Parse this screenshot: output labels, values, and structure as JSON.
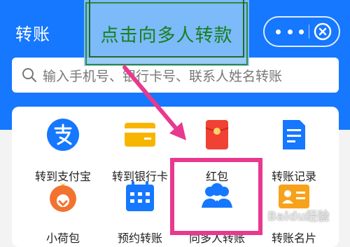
{
  "header": {
    "title": "转账",
    "more_icon": "more-dots-icon",
    "close_icon": "close-circle-icon"
  },
  "search": {
    "icon": "search-icon",
    "placeholder": "输入手机号、银行卡号、联系人姓名转账"
  },
  "grid": {
    "items": [
      {
        "label": "转到支付宝",
        "icon": "alipay-icon",
        "color": "#1677ff"
      },
      {
        "label": "转到银行卡",
        "icon": "bank-card-icon",
        "color": "#f7b500"
      },
      {
        "label": "红包",
        "icon": "red-packet-icon",
        "color": "#f04134"
      },
      {
        "label": "转账记录",
        "icon": "transfer-record-icon",
        "color": "#1677ff"
      },
      {
        "label": "小荷包",
        "icon": "purse-icon",
        "color": "#f2732f"
      },
      {
        "label": "预约转账",
        "icon": "calendar-icon",
        "color": "#1677ff"
      },
      {
        "label": "向多人转账",
        "icon": "multi-people-icon",
        "color": "#1677ff"
      },
      {
        "label": "转账名片",
        "icon": "name-card-icon",
        "color": "#f7a21b"
      }
    ]
  },
  "annotation": {
    "text": "点击向多人转款",
    "highlight_color": "#e8398e",
    "text_color": "#16801f"
  },
  "watermark": "Baidu经验"
}
